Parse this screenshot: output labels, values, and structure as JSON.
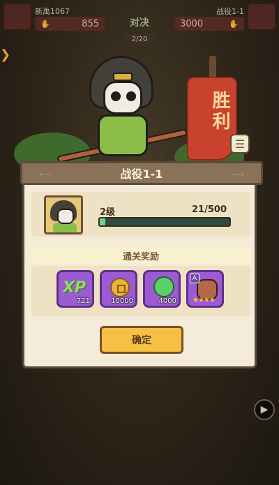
{
  "topbar": {
    "left_name": "新禹1067",
    "left_score": "855",
    "right_name": "战役1-1",
    "right_score": "3000",
    "vs_title": "对决",
    "round": "2/20"
  },
  "scene": {
    "banner_text": "胜利"
  },
  "dialog": {
    "title": "战役1-1",
    "level_label": "2级",
    "exp_text": "21/500",
    "exp_fraction": 0.042,
    "reward_title": "通关奖励",
    "rewards": [
      {
        "icon": "xp-icon",
        "xp_text": "XP",
        "amount": "721"
      },
      {
        "icon": "gold-coin-icon",
        "amount": "10000"
      },
      {
        "icon": "green-orb-icon",
        "amount": "4000"
      },
      {
        "icon": "hero-card-icon",
        "rank": "A",
        "stars": "★★★★"
      }
    ],
    "confirm_label": "确定"
  },
  "icons": {
    "menu": "list-menu-icon",
    "play": "play-icon"
  },
  "colors": {
    "accent": "#f5c044",
    "reward_bg": "#9c5bd2",
    "exp_fill": "#6ed488"
  }
}
